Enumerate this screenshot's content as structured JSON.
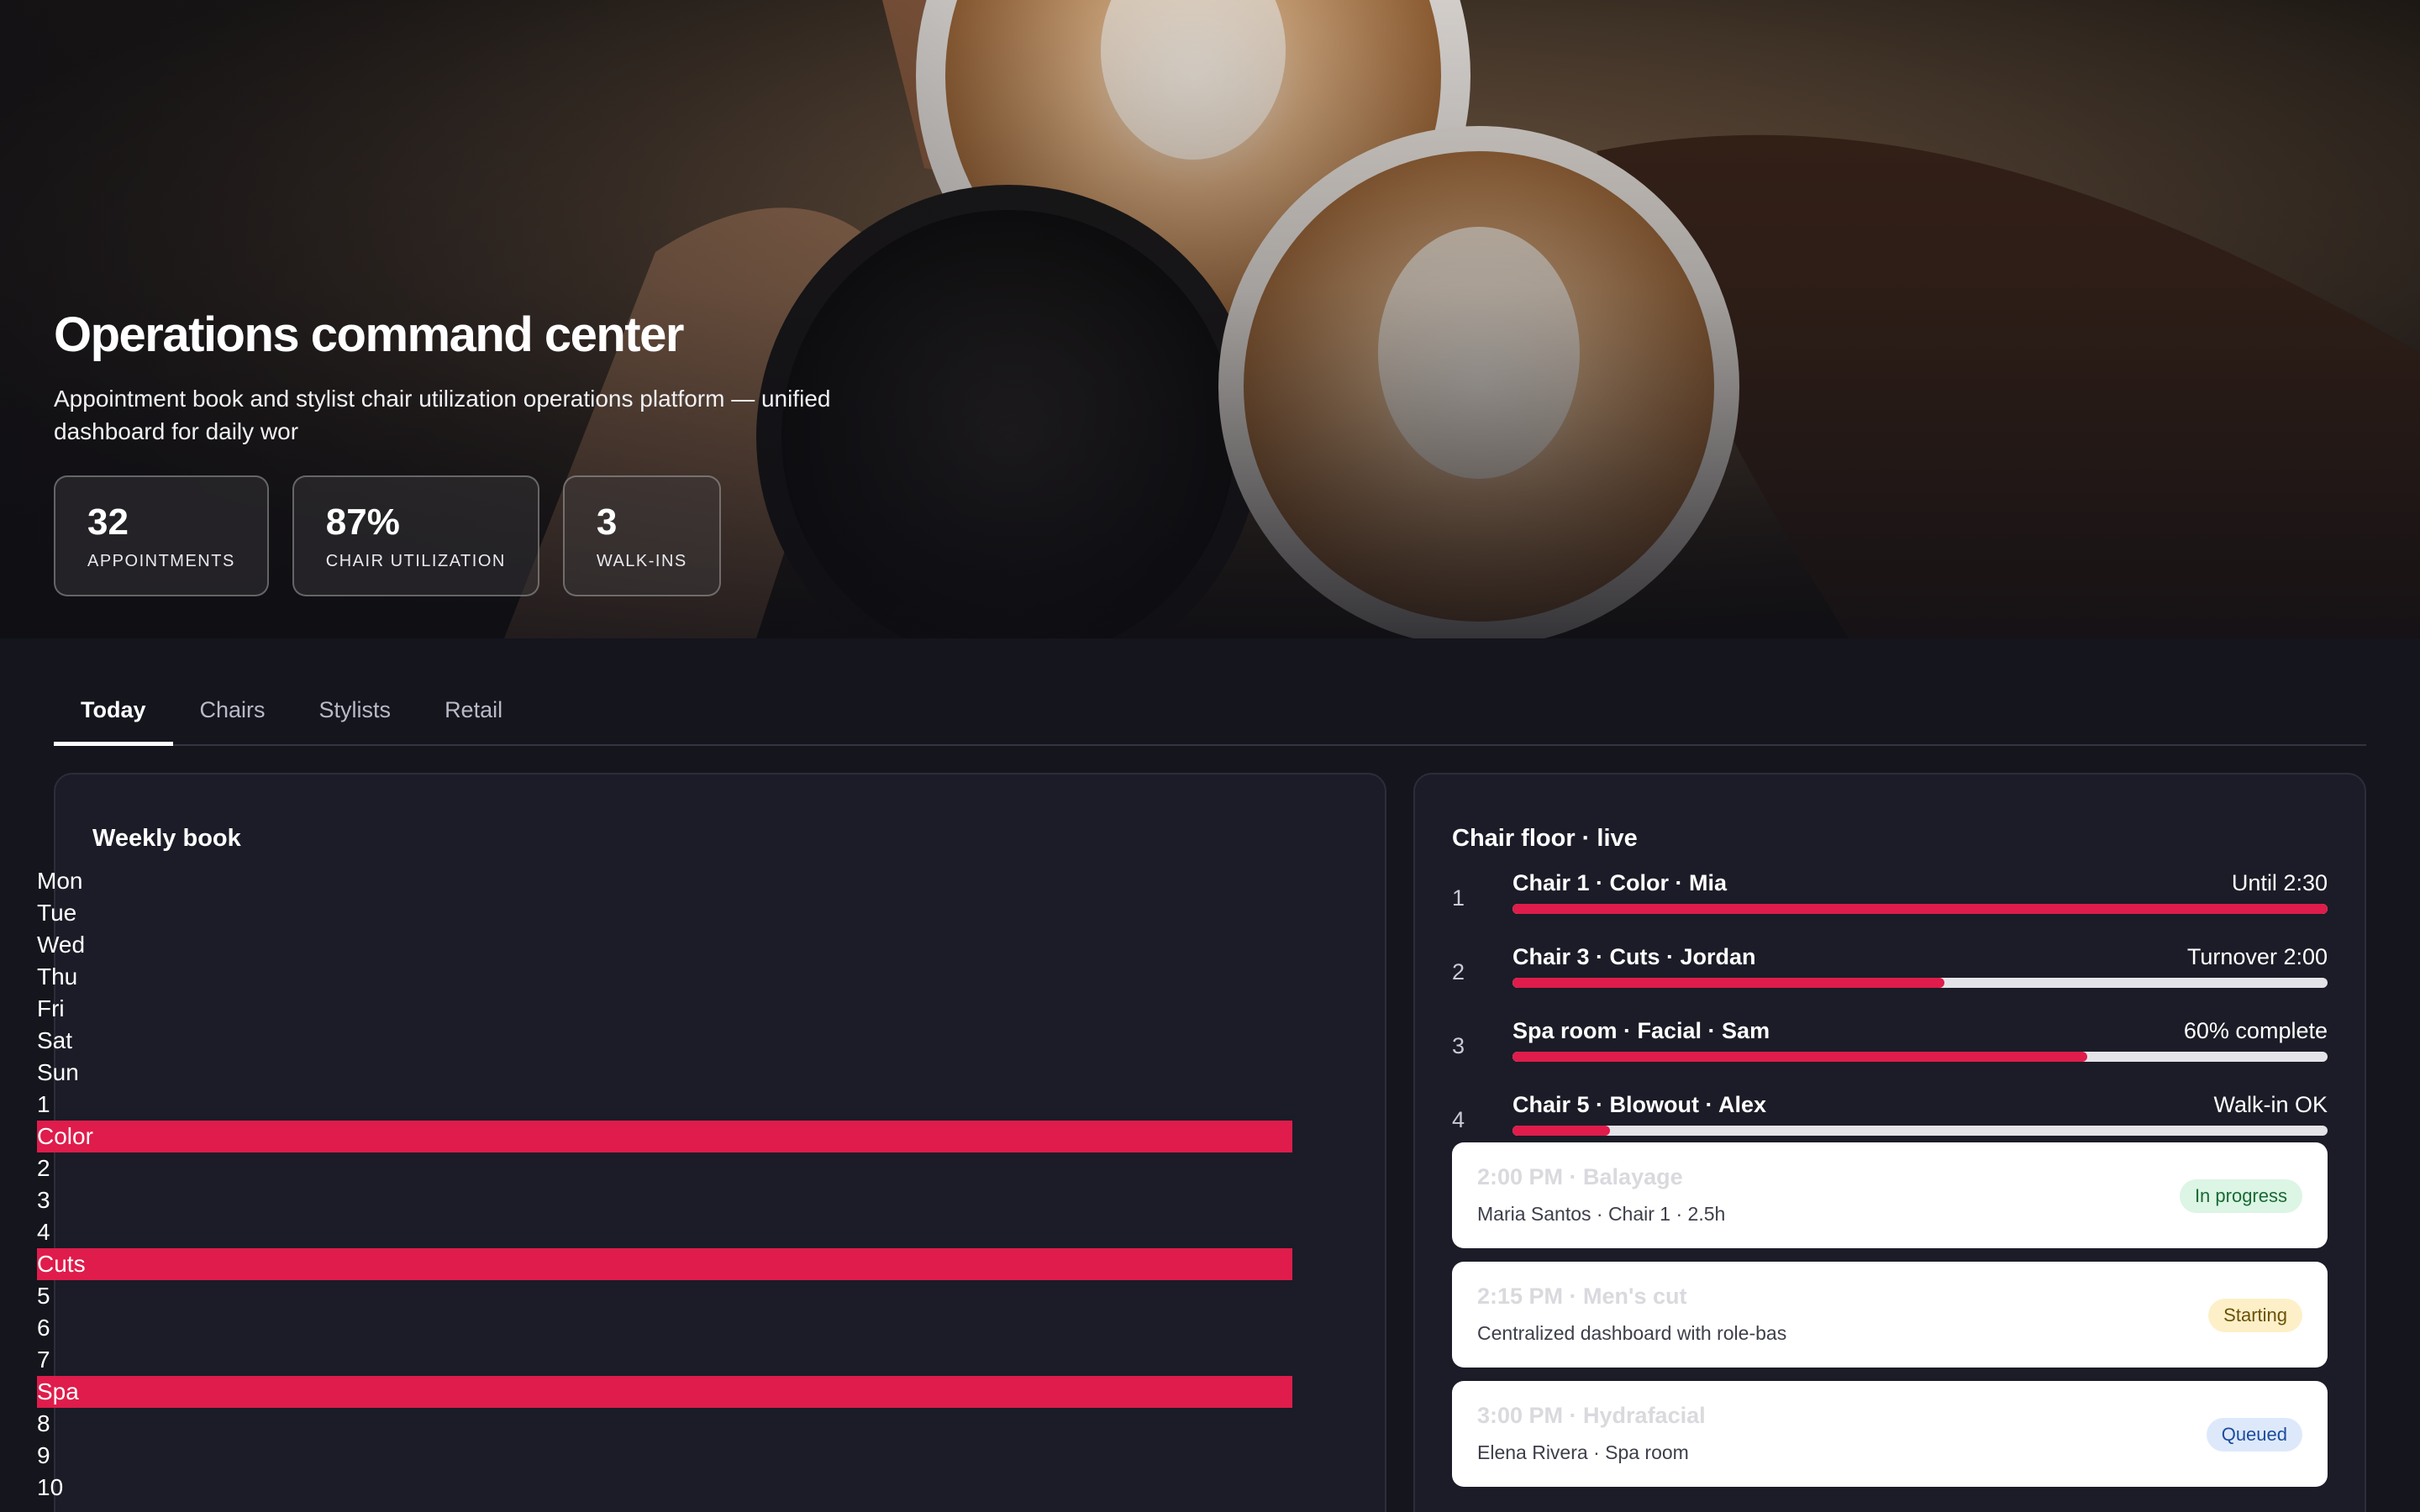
{
  "hero": {
    "title": "Operations command center",
    "subtitle": "Appointment book and stylist chair utilization operations platform — unified dashboard for daily wor",
    "stats": [
      {
        "value": "32",
        "label": "APPOINTMENTS"
      },
      {
        "value": "87%",
        "label": "CHAIR UTILIZATION"
      },
      {
        "value": "3",
        "label": "WALK-INS"
      }
    ]
  },
  "tabs": [
    {
      "label": "Today",
      "active": true
    },
    {
      "label": "Chairs",
      "active": false
    },
    {
      "label": "Stylists",
      "active": false
    },
    {
      "label": "Retail",
      "active": false
    }
  ],
  "weekly": {
    "title": "Weekly book",
    "rows": [
      {
        "text": "Mon",
        "bar": false
      },
      {
        "text": "Tue",
        "bar": false
      },
      {
        "text": "Wed",
        "bar": false
      },
      {
        "text": "Thu",
        "bar": false
      },
      {
        "text": "Fri",
        "bar": false
      },
      {
        "text": "Sat",
        "bar": false
      },
      {
        "text": "Sun",
        "bar": false
      },
      {
        "text": "1",
        "bar": false
      },
      {
        "text": "Color",
        "bar": true
      },
      {
        "text": "2",
        "bar": false
      },
      {
        "text": "3",
        "bar": false
      },
      {
        "text": "4",
        "bar": false
      },
      {
        "text": "Cuts",
        "bar": true
      },
      {
        "text": "5",
        "bar": false
      },
      {
        "text": "6",
        "bar": false
      },
      {
        "text": "7",
        "bar": false
      },
      {
        "text": "Spa",
        "bar": true
      },
      {
        "text": "8",
        "bar": false
      },
      {
        "text": "9",
        "bar": false
      },
      {
        "text": "10",
        "bar": false
      }
    ]
  },
  "chair_floor": {
    "title": "Chair floor · live",
    "chairs": [
      {
        "num": "1",
        "name": "Chair 1 · Color · Mia",
        "status": "Until 2:30",
        "progress": 1.0
      },
      {
        "num": "2",
        "name": "Chair 3 · Cuts · Jordan",
        "status": "Turnover 2:00",
        "progress": 0.53
      },
      {
        "num": "3",
        "name": "Spa room · Facial · Sam",
        "status": "60% complete",
        "progress": 0.705
      },
      {
        "num": "4",
        "name": "Chair 5 · Blowout · Alex",
        "status": "Walk-in OK",
        "progress": 0.12
      }
    ],
    "appointments": [
      {
        "title": "2:00 PM · Balayage",
        "sub": "Maria Santos · Chair 1 · 2.5h",
        "badge": "In progress",
        "badge_type": "progress"
      },
      {
        "title": "2:15 PM · Men's cut",
        "sub": "Centralized dashboard with role-bas",
        "badge": "Starting",
        "badge_type": "starting"
      },
      {
        "title": "3:00 PM · Hydrafacial",
        "sub": "Elena Rivera · Spa room",
        "badge": "Queued",
        "badge_type": "queued"
      }
    ]
  },
  "colors": {
    "accent": "#df1c4b",
    "background": "#14151d",
    "card": "#1b1c27"
  }
}
